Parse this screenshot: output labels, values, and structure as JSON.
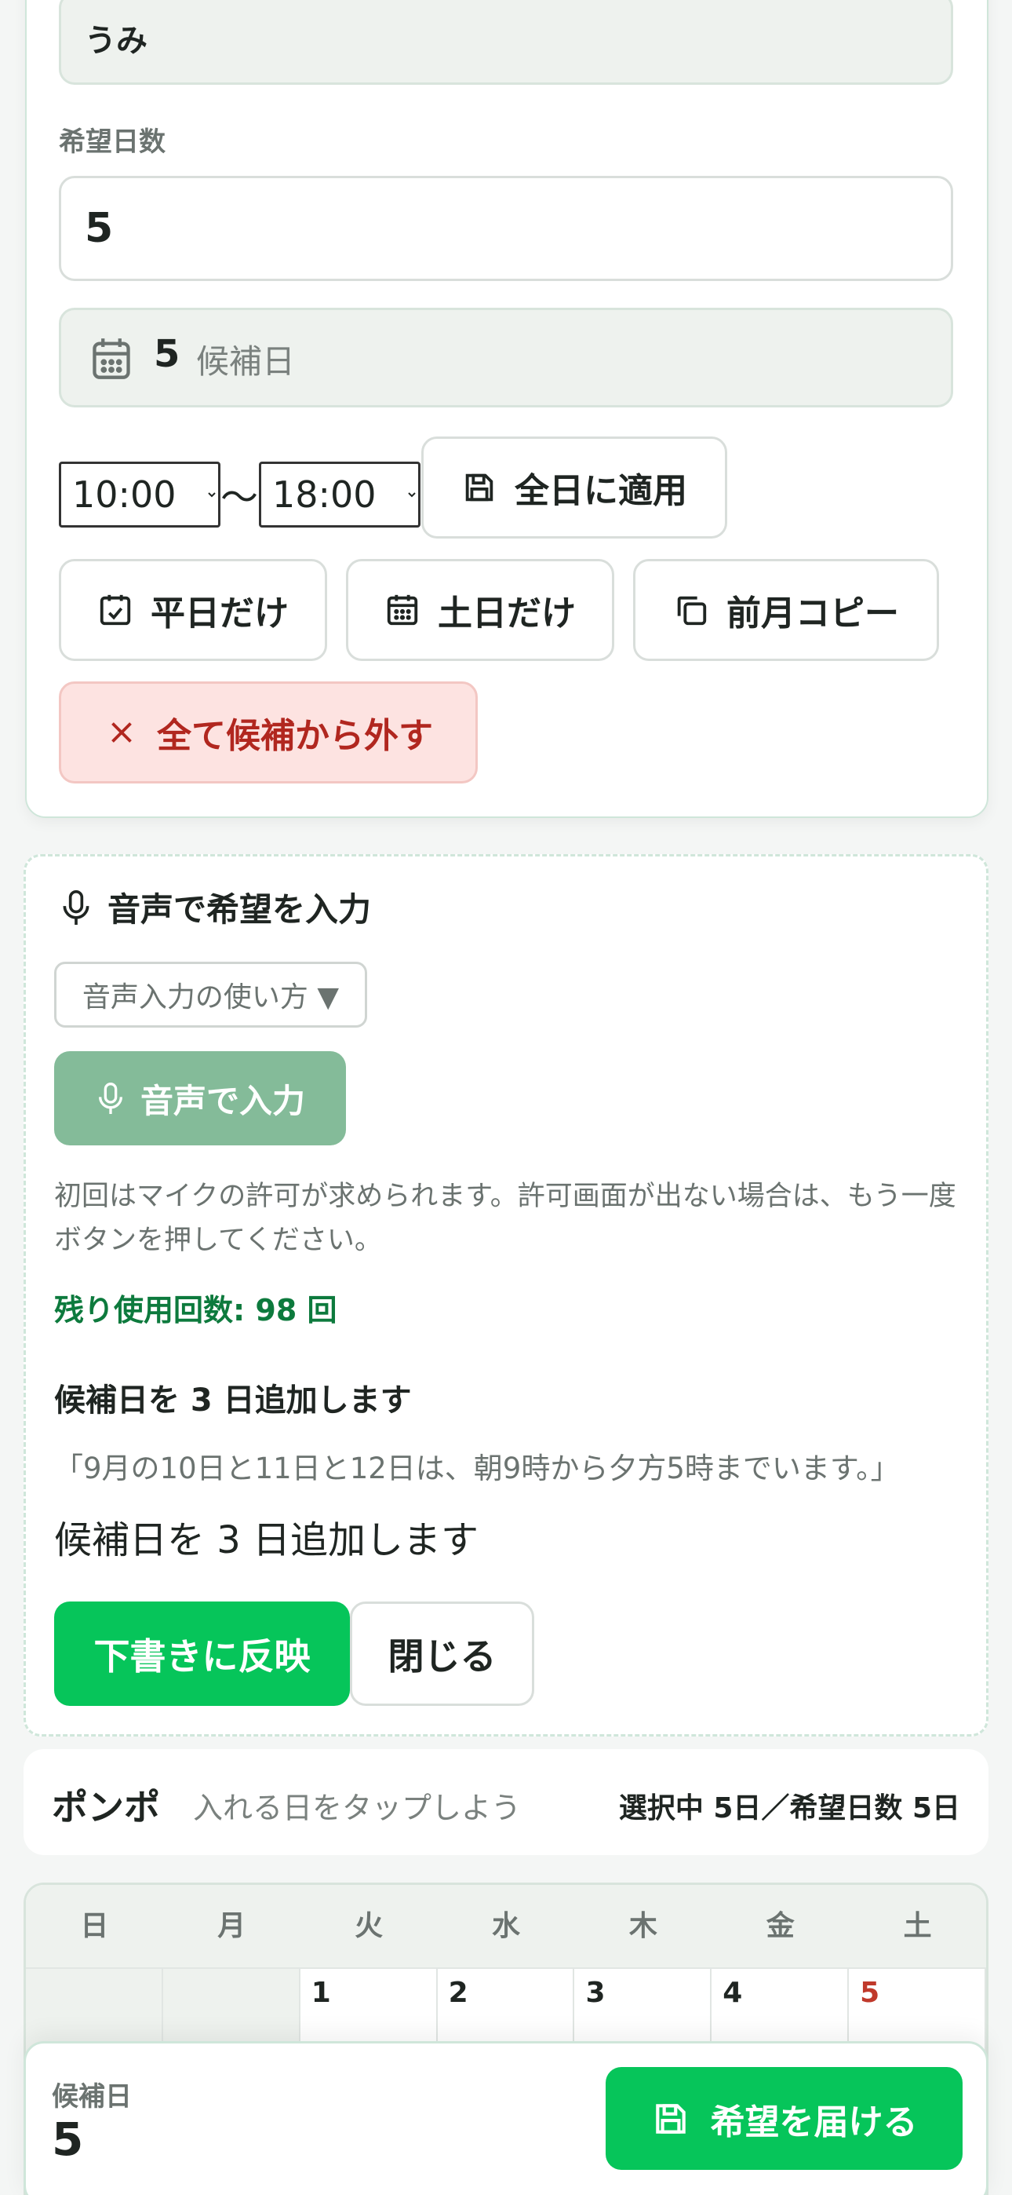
{
  "form": {
    "name_value": "うみ",
    "days_label": "希望日数",
    "days_value": "5",
    "candidate_count": "5",
    "candidate_suffix": "候補日",
    "time_start": "10:00",
    "time_end": "18:00",
    "time_options": [
      "10:00",
      "18:00"
    ],
    "tilde": "〜",
    "apply_all_label": "全日に適用",
    "weekdays_label": "平日だけ",
    "weekends_label": "土日だけ",
    "copy_prev_label": "前月コピー",
    "clear_all_label": "全て候補から外す"
  },
  "voice": {
    "title": "音声で希望を入力",
    "howto_label": "音声入力の使い方 ▼",
    "input_button": "音声で入力",
    "help_text": "初回はマイクの許可が求められます。許可画面が出ない場合は、もう一度ボタンを押してください。",
    "remaining": "残り使用回数: 98 回",
    "result_heading": "候補日を 3 日追加します",
    "transcript": "「9月の10日と11日と12日は、朝9時から夕方5時までいます。」",
    "result_text": "候補日を 3 日追加します",
    "apply_button": "下書きに反映",
    "close_button": "閉じる"
  },
  "bar": {
    "app_name": "ポンポ",
    "hint": "入れる日をタップしよう",
    "status": "選択中 5日／希望日数 5日"
  },
  "calendar": {
    "weekdays": [
      "日",
      "月",
      "火",
      "水",
      "木",
      "金",
      "土"
    ],
    "first_row": [
      "",
      "",
      "1",
      "2",
      "3",
      "4",
      "5"
    ]
  },
  "footer": {
    "label": "候補日",
    "value": "5",
    "submit_label": "希望を届ける"
  },
  "colors": {
    "primary_green": "#06c55a",
    "disabled_green": "#84bb99",
    "danger_text": "#b1271f",
    "danger_bg": "#fde3e1",
    "remaining_text": "#0d7a3d",
    "saturday_red": "#c0392b"
  }
}
